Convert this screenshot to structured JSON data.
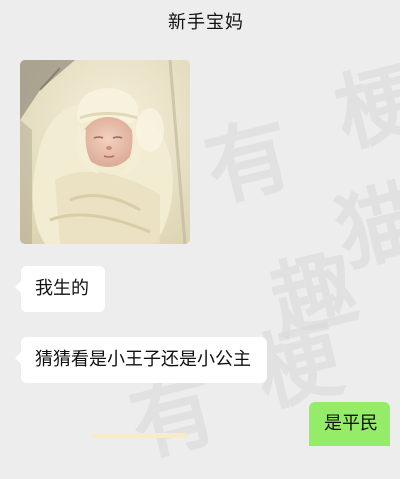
{
  "header": {
    "title": "新手宝妈"
  },
  "messages": [
    {
      "type": "image",
      "direction": "incoming",
      "image": "newborn-baby-swaddled-photo"
    },
    {
      "type": "text",
      "direction": "incoming",
      "text": "我生的"
    },
    {
      "type": "text",
      "direction": "incoming",
      "text": "猜猜看是小王子还是小公主"
    },
    {
      "type": "text",
      "direction": "outgoing",
      "text": "是平民"
    }
  ],
  "watermark": {
    "glyphs": [
      "有",
      "趣",
      "猫",
      "梗"
    ]
  },
  "colors": {
    "background": "#ededed",
    "incoming_bubble": "#ffffff",
    "outgoing_bubble": "#95ec69"
  }
}
